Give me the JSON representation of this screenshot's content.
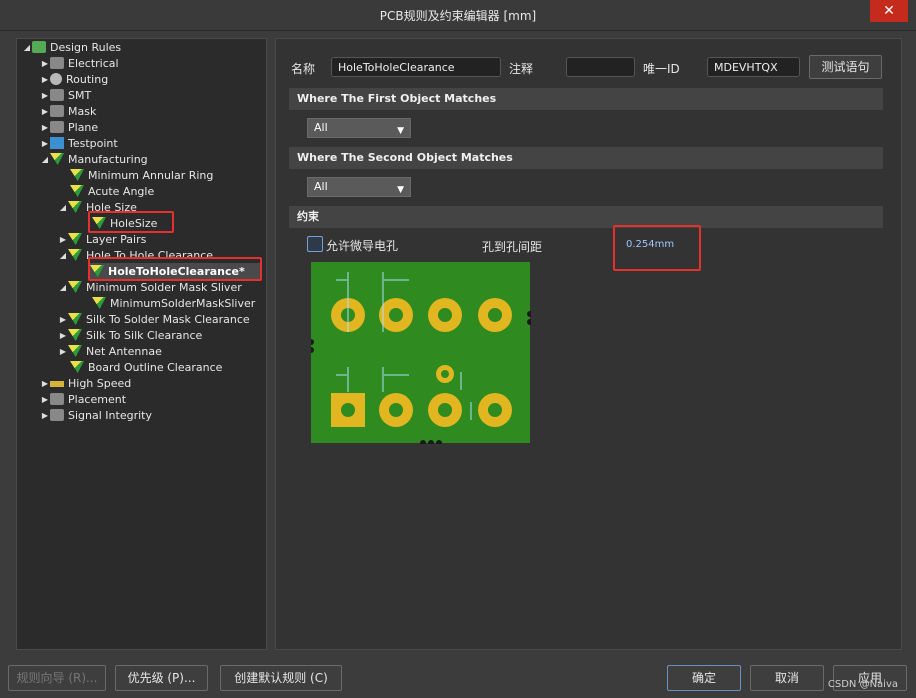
{
  "window": {
    "title": "PCB规则及约束编辑器 [mm]",
    "close_glyph": "✕"
  },
  "tree": {
    "items": [
      {
        "label": "Design Rules",
        "icon": "design-rules-icon"
      },
      {
        "label": "Electrical",
        "icon": "electrical-icon"
      },
      {
        "label": "Routing",
        "icon": "routing-icon"
      },
      {
        "label": "SMT",
        "icon": "smt-icon"
      },
      {
        "label": "Mask",
        "icon": "mask-icon"
      },
      {
        "label": "Plane",
        "icon": "plane-icon"
      },
      {
        "label": "Testpoint",
        "icon": "testpoint-icon"
      },
      {
        "label": "Manufacturing",
        "icon": "rule-icon"
      },
      {
        "label": "Minimum Annular Ring",
        "icon": "rule-icon"
      },
      {
        "label": "Acute Angle",
        "icon": "rule-icon"
      },
      {
        "label": "Hole Size",
        "icon": "rule-icon"
      },
      {
        "label": "HoleSize",
        "icon": "rule-icon"
      },
      {
        "label": "Layer Pairs",
        "icon": "rule-icon"
      },
      {
        "label": "Hole To Hole Clearance",
        "icon": "rule-icon"
      },
      {
        "label": "HoleToHoleClearance*",
        "icon": "rule-icon"
      },
      {
        "label": "Minimum Solder Mask Sliver",
        "icon": "rule-icon"
      },
      {
        "label": "MinimumSolderMaskSliver",
        "icon": "rule-icon"
      },
      {
        "label": "Silk To Solder Mask Clearance",
        "icon": "rule-icon"
      },
      {
        "label": "Silk To Silk Clearance",
        "icon": "rule-icon"
      },
      {
        "label": "Net Antennae",
        "icon": "rule-icon"
      },
      {
        "label": "Board Outline Clearance",
        "icon": "rule-icon"
      },
      {
        "label": "High Speed",
        "icon": "high-speed-icon"
      },
      {
        "label": "Placement",
        "icon": "placement-icon"
      },
      {
        "label": "Signal Integrity",
        "icon": "signal-integrity-icon"
      }
    ]
  },
  "rule": {
    "name_label": "名称",
    "name_value": "HoleToHoleClearance",
    "comment_label": "注释",
    "comment_value": "",
    "uid_label": "唯一ID",
    "uid_value": "MDEVHTQX",
    "test_button": "测试语句"
  },
  "first_match": {
    "header": "Where The First Object Matches",
    "selected": "All"
  },
  "second_match": {
    "header": "Where The Second Object Matches",
    "selected": "All"
  },
  "constraints": {
    "header": "约束",
    "allow_micro_vias_label": "允许微导电孔",
    "allow_micro_vias_checked": false,
    "hole_clearance_label": "孔到孔间距",
    "hole_clearance_value": "0.254mm"
  },
  "footer": {
    "wizard_button": "规则向导 (R)...",
    "priority_button": "优先级 (P)...",
    "create_default_button": "创建默认规则 (C)",
    "ok_button": "确定",
    "cancel_button": "取消",
    "apply_button": "应用",
    "watermark": "CSDN @Naiva"
  },
  "colors": {
    "board_green": "#2f8a1f",
    "pad_gold": "#e2b621",
    "highlight_red": "#e53030",
    "background": "#3c3c3c"
  }
}
